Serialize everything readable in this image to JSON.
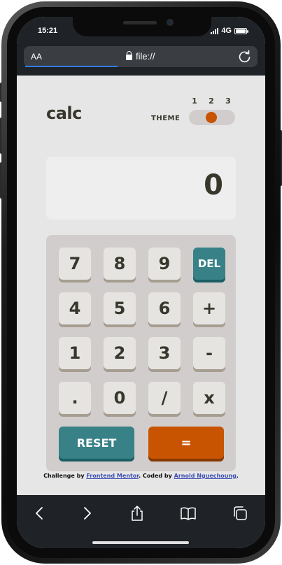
{
  "status_bar": {
    "time": "15:21",
    "network": "4G",
    "signal_bars": 4,
    "battery_level": 1.0
  },
  "browser": {
    "text_size_label": "AA",
    "url": "file://",
    "icons": [
      "lock-icon",
      "reload-icon",
      "back-icon",
      "forward-icon",
      "share-icon",
      "bookmarks-icon",
      "tabs-icon"
    ]
  },
  "app": {
    "logo": "calc",
    "theme": {
      "label": "THEME",
      "options": [
        "1",
        "2",
        "3"
      ],
      "selected": "2"
    },
    "display_value": "0",
    "keys": {
      "seven": "7",
      "eight": "8",
      "nine": "9",
      "del": "DEL",
      "four": "4",
      "five": "5",
      "six": "6",
      "plus": "+",
      "one": "1",
      "two": "2",
      "three": "3",
      "minus": "-",
      "dot": ".",
      "zero": "0",
      "divide": "/",
      "multiply": "x",
      "reset": "RESET",
      "equals": "="
    },
    "credit": {
      "prefix": "Challenge by ",
      "link1": "Frontend Mentor",
      "middle": ". Coded by ",
      "link2": "Arnold Nguechoung",
      "suffix": "."
    }
  },
  "colors": {
    "background": "#e6e6e6",
    "keypad": "#d2cdcd",
    "key": "#e5e4e1",
    "accent_teal": "#378187",
    "accent_orange": "#c85402",
    "text_dark": "#37372c",
    "browser_chrome": "#1f2226"
  }
}
